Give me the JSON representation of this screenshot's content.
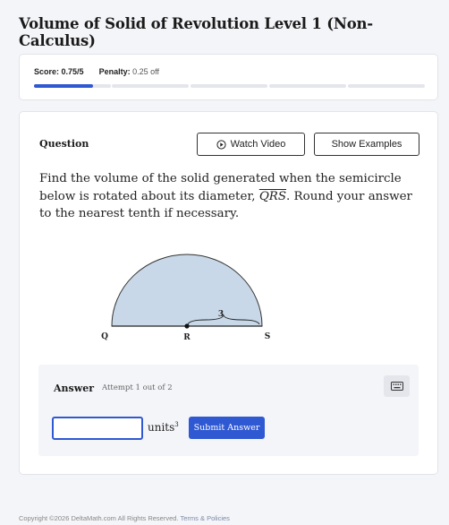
{
  "page": {
    "title": "Volume of Solid of Revolution Level 1 (Non-Calculus)"
  },
  "score": {
    "score_label": "Score:",
    "score_value": "0.75/5",
    "penalty_label": "Penalty:",
    "penalty_value": "0.25 off",
    "progress_fraction": 0.15
  },
  "question": {
    "label": "Question",
    "watch_video": "Watch Video",
    "show_examples": "Show Examples",
    "prompt_before": "Find the volume of the solid generated when the semicircle below is rotated about its diameter, ",
    "segment": "QRS",
    "prompt_after": ". Round your answer to the nearest tenth if necessary."
  },
  "diagram": {
    "point_q": "Q",
    "point_r": "R",
    "point_s": "S",
    "radius_label": "3",
    "fill_color": "#c8d8e8"
  },
  "answer": {
    "label": "Answer",
    "attempt": "Attempt 1 out of 2",
    "input_value": "",
    "units": "units",
    "units_exp": "3",
    "submit": "Submit Answer"
  },
  "footer": {
    "copyright": "Copyright ©2026 DeltaMath.com All Rights Reserved.",
    "terms": "Terms & Policies"
  },
  "colors": {
    "accent": "#2f58d3",
    "background": "#f4f5f8"
  }
}
